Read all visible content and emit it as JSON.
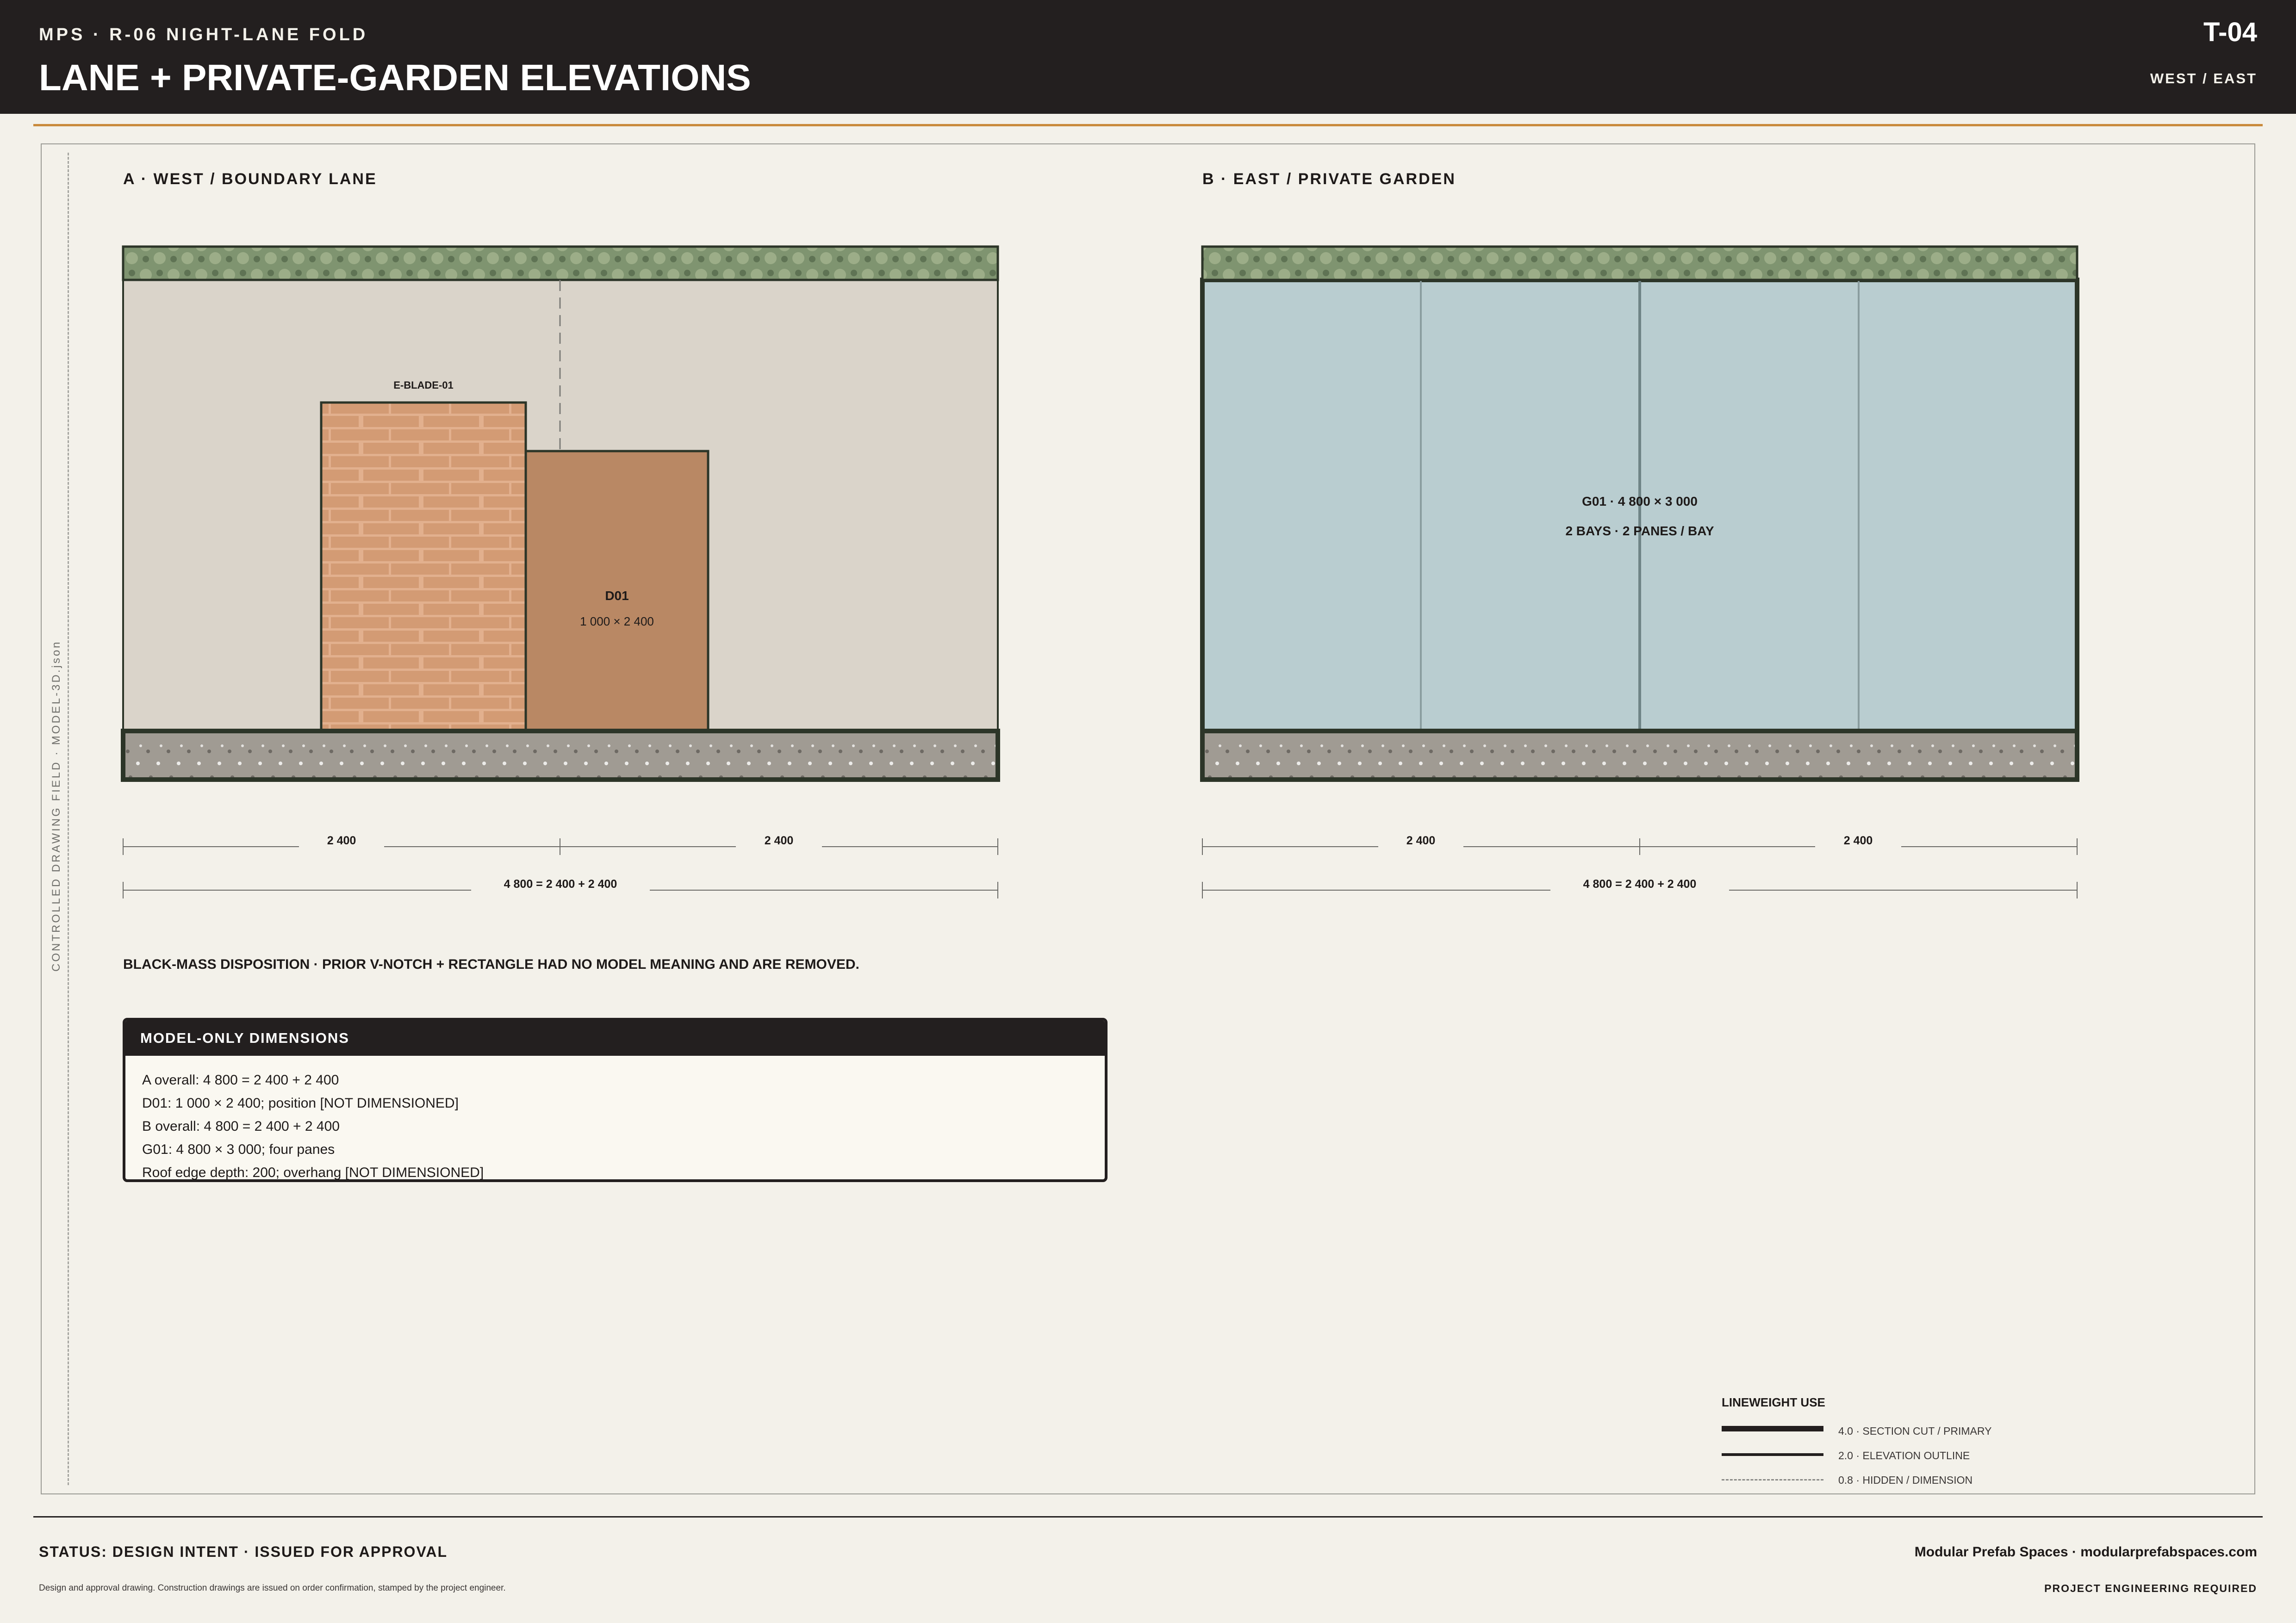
{
  "header": {
    "project": "MPS · R-06 NIGHT-LANE FOLD",
    "title": "LANE + PRIVATE-GARDEN ELEVATIONS",
    "sheet_number": "T-04",
    "views": "WEST / EAST"
  },
  "side_label": "CONTROLLED DRAWING FIELD · MODEL-3D.json",
  "panel_a": {
    "title": "A · WEST / BOUNDARY LANE",
    "blade_label": "E-BLADE-01",
    "door_label": "D01",
    "door_size": "1 000 × 2 400",
    "dim_left": "2 400",
    "dim_right": "2 400",
    "dim_overall": "4 800 = 2 400 + 2 400"
  },
  "panel_b": {
    "title": "B · EAST / PRIVATE GARDEN",
    "glazing_label": "G01 · 4 800 × 3 000",
    "glazing_note": "2 BAYS · 2 PANES / BAY",
    "dim_left": "2 400",
    "dim_right": "2 400",
    "dim_overall": "4 800 = 2 400 + 2 400"
  },
  "note": "BLACK-MASS DISPOSITION · PRIOR V-NOTCH + RECTANGLE HAD NO MODEL MEANING AND ARE REMOVED.",
  "model_dimensions": {
    "title": "MODEL-ONLY DIMENSIONS",
    "items": [
      "A overall: 4 800 = 2 400 + 2 400",
      "D01: 1 000 × 2 400; position [NOT DIMENSIONED]",
      "B overall: 4 800 = 2 400 + 2 400",
      "G01: 4 800 × 3 000; four panes",
      "Roof edge depth: 200; overhang [NOT DIMENSIONED]"
    ]
  },
  "legend": {
    "title": "LINEWEIGHT USE",
    "items": [
      {
        "weight": 4.0,
        "label": "4.0 · SECTION CUT / PRIMARY"
      },
      {
        "weight": 2.0,
        "label": "2.0 · ELEVATION OUTLINE"
      },
      {
        "weight": 0.8,
        "label": "0.8 · HIDDEN / DIMENSION"
      }
    ]
  },
  "footer": {
    "status": "STATUS: DESIGN INTENT · ISSUED FOR APPROVAL",
    "disclaimer": "Design and approval drawing. Construction drawings are issued on order confirmation, stamped by the project engineer.",
    "company": "Modular Prefab Spaces · modularprefabspaces.com",
    "engineering": "PROJECT ENGINEERING REQUIRED"
  },
  "colors": {
    "header_bg": "#231f1f",
    "accent": "#c98a3c",
    "roof_green": "#7f9470",
    "wall": "#dad4ca",
    "brick": "#c8916e",
    "door": "#b98864",
    "glass": "#b9cdd0",
    "base_concrete": "#a09b93"
  }
}
